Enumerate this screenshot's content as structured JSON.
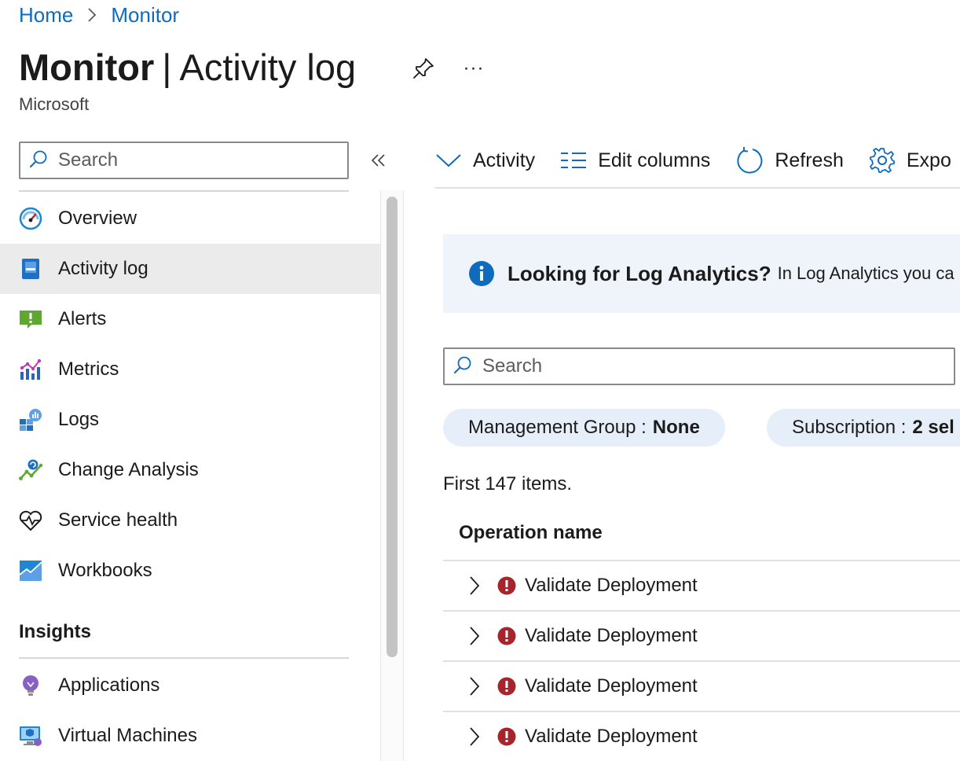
{
  "breadcrumb": {
    "items": [
      "Home",
      "Monitor"
    ]
  },
  "header": {
    "title_bold": "Monitor",
    "title_sep": "|",
    "title_rest": "Activity log",
    "subtitle": "Microsoft",
    "more_label": "···"
  },
  "sidebar": {
    "search_placeholder": "Search",
    "items": [
      {
        "label": "Overview",
        "icon": "gauge-icon"
      },
      {
        "label": "Activity log",
        "icon": "activity-log-icon",
        "active": true
      },
      {
        "label": "Alerts",
        "icon": "alert-icon"
      },
      {
        "label": "Metrics",
        "icon": "metrics-icon"
      },
      {
        "label": "Logs",
        "icon": "logs-icon"
      },
      {
        "label": "Change Analysis",
        "icon": "change-analysis-icon"
      },
      {
        "label": "Service health",
        "icon": "service-health-icon"
      },
      {
        "label": "Workbooks",
        "icon": "workbooks-icon"
      }
    ],
    "section_title": "Insights",
    "section_items": [
      {
        "label": "Applications",
        "icon": "lightbulb-icon"
      },
      {
        "label": "Virtual Machines",
        "icon": "virtual-machine-icon"
      }
    ]
  },
  "toolbar": {
    "activity": "Activity",
    "edit_columns": "Edit columns",
    "refresh": "Refresh",
    "export": "Expo"
  },
  "banner": {
    "title": "Looking for Log Analytics?",
    "text": "In Log Analytics you ca"
  },
  "search": {
    "placeholder": "Search"
  },
  "filters": [
    {
      "label": "Management Group :",
      "value": "None"
    },
    {
      "label": "Subscription :",
      "value": "2 sel"
    }
  ],
  "results": {
    "count_text": "First 147 items.",
    "column_header": "Operation name",
    "rows": [
      {
        "name": "Validate Deployment",
        "status": "error"
      },
      {
        "name": "Validate Deployment",
        "status": "error"
      },
      {
        "name": "Validate Deployment",
        "status": "error"
      },
      {
        "name": "Validate Deployment",
        "status": "error"
      }
    ]
  },
  "colors": {
    "link": "#0f6cbd",
    "active_bg": "#ebebeb",
    "banner_bg": "#eff4fb",
    "pill_bg": "#e6eff9",
    "error": "#a4262c",
    "info": "#0f6cbd"
  }
}
